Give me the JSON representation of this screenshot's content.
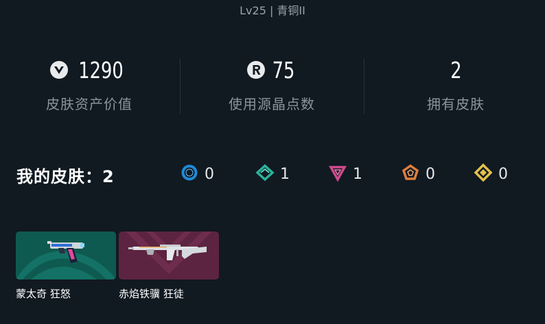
{
  "header": {
    "level_text": "Lv25 | 青铜II"
  },
  "stats": [
    {
      "icon": "valorant-points-icon",
      "value": "1290",
      "label": "皮肤资产价值"
    },
    {
      "icon": "radianite-points-icon",
      "value": "75",
      "label": "使用源晶点数"
    },
    {
      "icon": "",
      "value": "2",
      "label": "拥有皮肤"
    }
  ],
  "skins": {
    "title": "我的皮肤：2",
    "tiers": [
      {
        "icon": "select-tier-icon",
        "color": "#1e8ad6",
        "count": "0"
      },
      {
        "icon": "deluxe-tier-icon",
        "color": "#2bb39a",
        "count": "1"
      },
      {
        "icon": "premium-tier-icon",
        "color": "#d04a8c",
        "count": "1"
      },
      {
        "icon": "exclusive-tier-icon",
        "color": "#e07f3a",
        "count": "0"
      },
      {
        "icon": "ultra-tier-icon",
        "color": "#e4c24a",
        "count": "0"
      }
    ],
    "items": [
      {
        "name": "蒙太奇 狂怒",
        "bg_color": "#0f5a50",
        "weapon": "pistol-skin-icon"
      },
      {
        "name": "赤焰铁骥 狂徒",
        "bg_color": "#5c2440",
        "weapon": "rifle-skin-icon"
      }
    ]
  }
}
